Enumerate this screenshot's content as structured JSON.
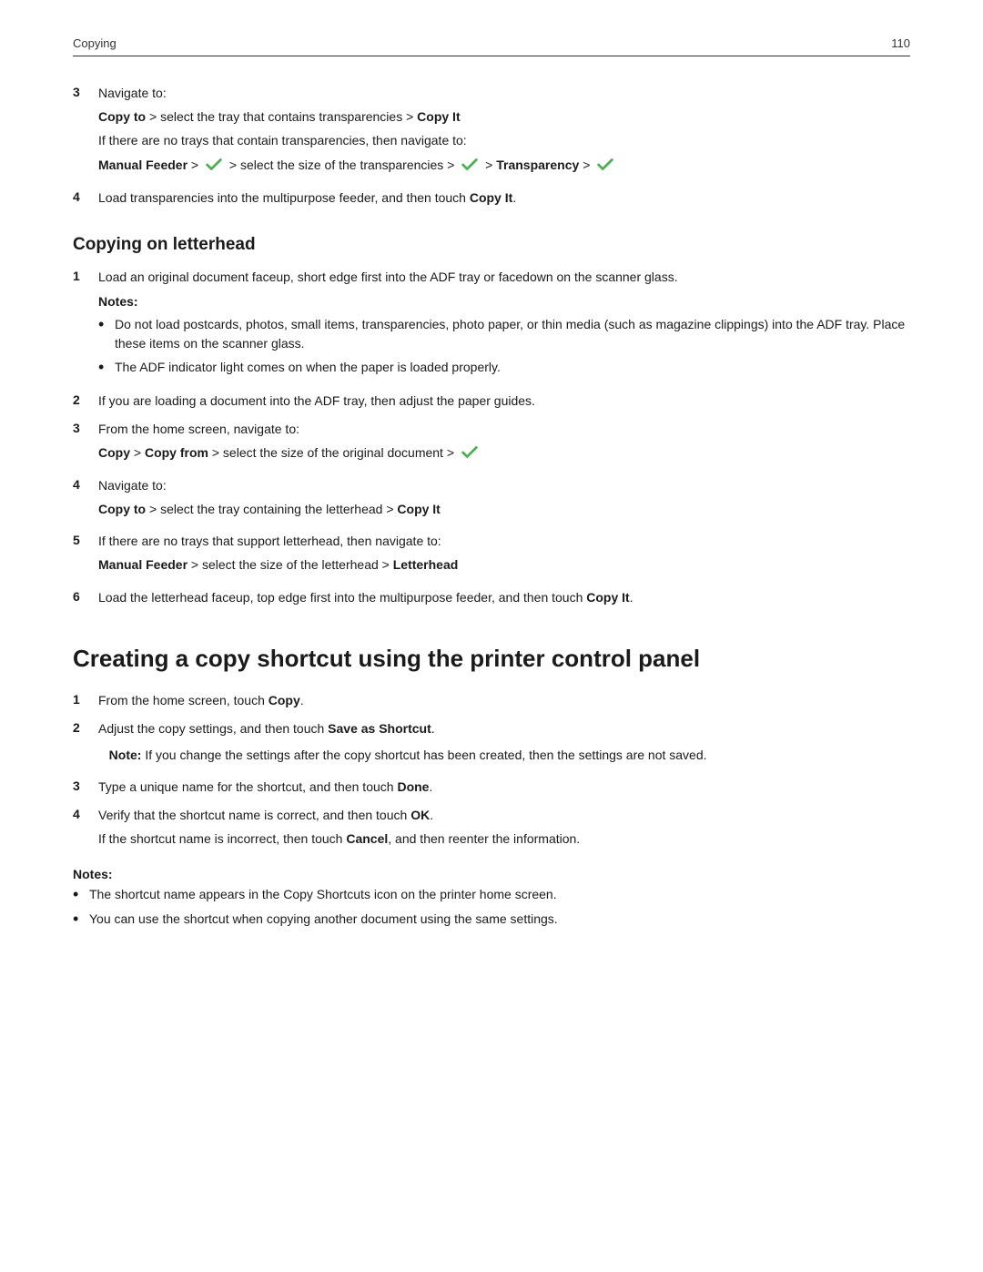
{
  "header": {
    "section": "Copying",
    "page_number": "110"
  },
  "step3_nav": {
    "label": "3",
    "navigate_to": "Navigate to:",
    "copy_to_line": "Copy to > select the tray that contains transparencies > Copy It",
    "if_no_trays": "If there are no trays that contain transparencies, then navigate to:",
    "manual_feeder_line_parts": [
      "Manual Feeder",
      " > ",
      " > select the size of the transparencies > ",
      " > ",
      "Transparency",
      " > "
    ]
  },
  "step4_nav": {
    "label": "4",
    "text_before": "Load transparencies into the multipurpose feeder, and then touch ",
    "bold": "Copy It",
    "text_after": "."
  },
  "copying_letterhead": {
    "heading": "Copying on letterhead",
    "step1_label": "1",
    "step1_text": "Load an original document faceup, short edge first into the ADF tray or facedown on the scanner glass.",
    "notes_label": "Notes:",
    "bullet1": "Do not load postcards, photos, small items, transparencies, photo paper, or thin media (such as magazine clippings) into the ADF tray. Place these items on the scanner glass.",
    "bullet2": "The ADF indicator light comes on when the paper is loaded properly.",
    "step2_label": "2",
    "step2_text": "If you are loading a document into the ADF tray, then adjust the paper guides.",
    "step3_label": "3",
    "step3_text": "From the home screen, navigate to:",
    "step3_nav_line_parts": [
      "Copy",
      " > ",
      "Copy from",
      " > select the size of the original document > "
    ],
    "step4_label": "4",
    "step4_text": "Navigate to:",
    "step4_nav_line": "Copy to > select the tray containing the letterhead > Copy It",
    "step5_label": "5",
    "step5_text": "If there are no trays that support letterhead, then navigate to:",
    "step5_nav_parts": [
      "Manual Feeder",
      " > select the size of the letterhead > ",
      "Letterhead"
    ],
    "step6_label": "6",
    "step6_text_before": "Load the letterhead faceup, top edge first into the multipurpose feeder, and then touch ",
    "step6_bold": "Copy It",
    "step6_text_after": "."
  },
  "creating_shortcut": {
    "heading": "Creating a copy shortcut using the printer control panel",
    "step1_label": "1",
    "step1_text_before": "From the home screen, touch ",
    "step1_bold": "Copy",
    "step1_text_after": ".",
    "step2_label": "2",
    "step2_text_before": "Adjust the copy settings, and then touch ",
    "step2_bold": "Save as Shortcut",
    "step2_text_after": ".",
    "note_label": "Note:",
    "note_text": " If you change the settings after the copy shortcut has been created, then the settings are not saved.",
    "step3_label": "3",
    "step3_text_before": "Type a unique name for the shortcut, and then touch ",
    "step3_bold": "Done",
    "step3_text_after": ".",
    "step4_label": "4",
    "step4_text_before": "Verify that the shortcut name is correct, and then touch ",
    "step4_bold": "OK",
    "step4_text_after": ".",
    "step4_if_text_before": "If the shortcut name is incorrect, then touch ",
    "step4_if_bold": "Cancel",
    "step4_if_text_after": ", and then reenter the information.",
    "notes_label": "Notes:",
    "bullet1": "The shortcut name appears in the Copy Shortcuts icon on the printer home screen.",
    "bullet2": "You can use the shortcut when copying another document using the same settings."
  }
}
